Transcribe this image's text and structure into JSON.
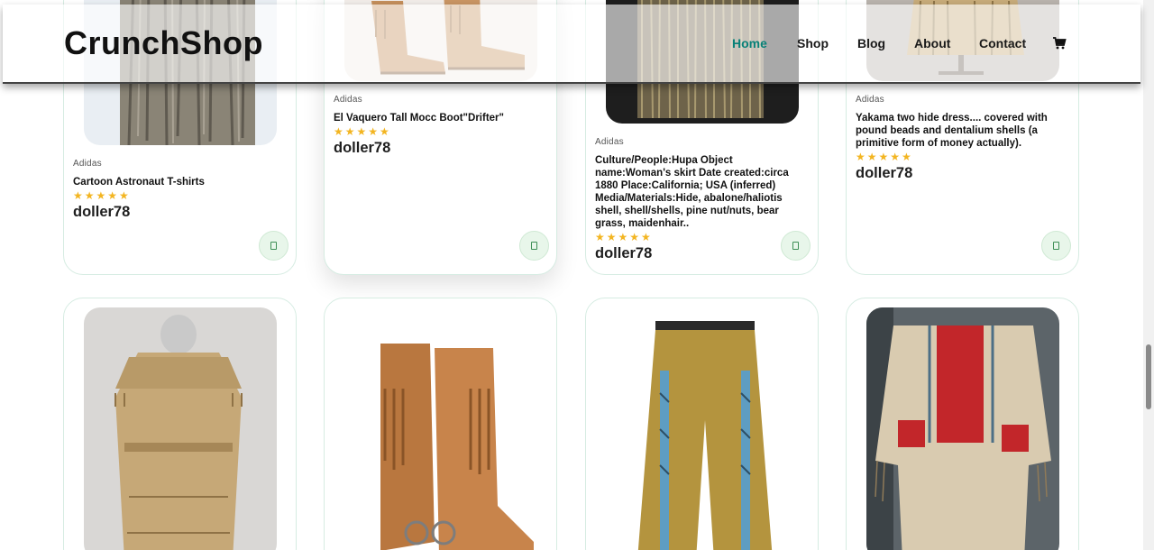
{
  "navbar": {
    "logo": "CrunchShop",
    "menu": [
      {
        "label": "Home",
        "active": true
      },
      {
        "label": "Shop",
        "active": false
      },
      {
        "label": "Blog",
        "active": false
      },
      {
        "label": "About",
        "active": false
      },
      {
        "label": "Contact",
        "active": false
      }
    ],
    "cart_icon": "shopping-cart-icon",
    "accent_color": "#088178"
  },
  "products_row1": [
    {
      "brand": "Adidas",
      "title": "Cartoon Astronaut T-shirts",
      "stars": "★★★★★",
      "rating": 5,
      "price": "doller78"
    },
    {
      "brand": "Adidas",
      "title": "El Vaquero Tall Mocc Boot\"Drifter\"",
      "stars": "★★★★★",
      "rating": 5,
      "price": "doller78"
    },
    {
      "brand": "Adidas",
      "title": "Culture/People:Hupa Object name:Woman's skirt Date created:circa 1880 Place:California; USA (inferred) Media/Materials:Hide, abalone/haliotis shell, shell/shells, pine nut/nuts, bear grass, maidenhair..",
      "stars": "★★★★★",
      "rating": 5,
      "price": "doller78"
    },
    {
      "brand": "Adidas",
      "title": "Yakama two hide dress.... covered with pound beads and dentalium shells (a primitive form of money actually).",
      "stars": "★★★★★",
      "rating": 5,
      "price": "doller78"
    }
  ],
  "products_row2": [
    {
      "image": "fringed buckskin coat"
    },
    {
      "image": "fringed leather boots"
    },
    {
      "image": "beaded buckskin trousers"
    },
    {
      "image": "beaded hide shirt"
    }
  ],
  "colors": {
    "star": "#f3b521",
    "card_border": "#d6ece2",
    "cart_button_bg": "#e8f6ea"
  }
}
